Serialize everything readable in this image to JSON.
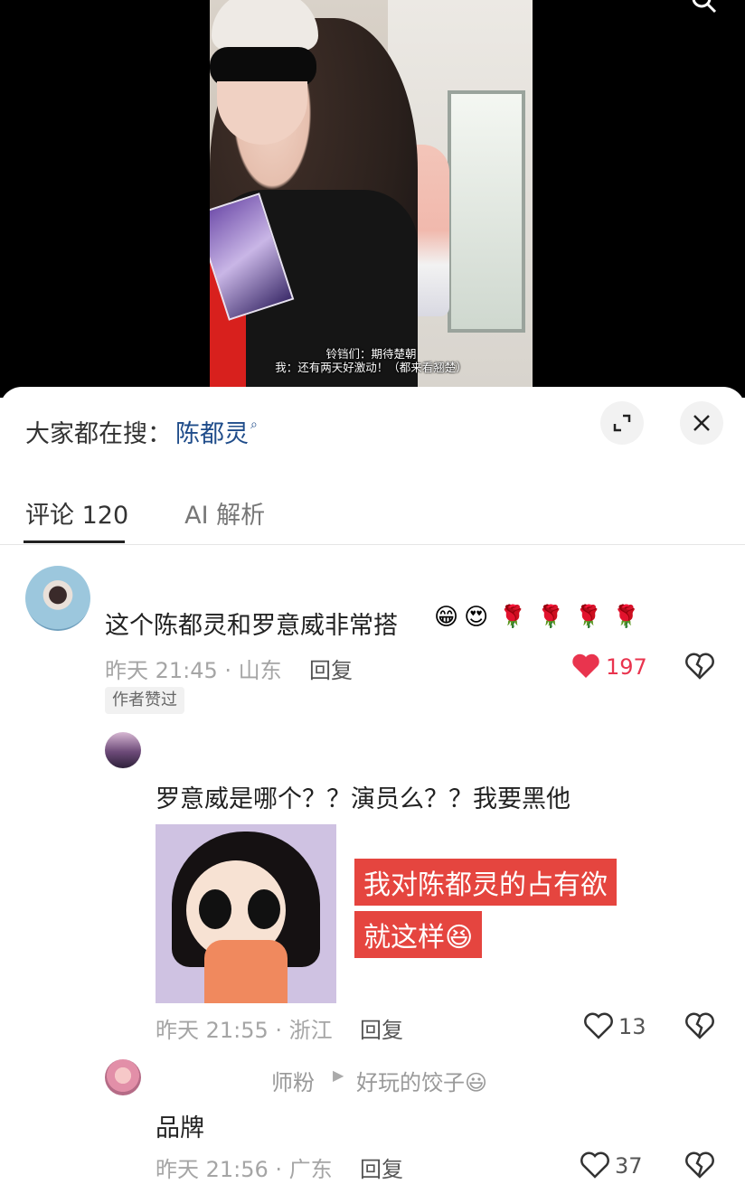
{
  "video": {
    "caption_line1": "铃铛们：期待楚朝",
    "caption_line2": "我：还有两天好激动！（都来看翘楚）"
  },
  "search": {
    "prefix": "大家都在搜：",
    "term": "陈都灵"
  },
  "tabs": [
    {
      "label": "评论 120",
      "active": true
    },
    {
      "label": "AI 解析",
      "active": false
    }
  ],
  "comments": [
    {
      "text": "这个陈都灵和罗意威非常搭",
      "emojis": [
        "😁",
        "😍",
        "🌹",
        "🌹",
        "🌹",
        "🌹"
      ],
      "time_location": "昨天 21:45 · 山东",
      "reply_label": "回复",
      "likes": "197",
      "liked": true,
      "badge": "作者赞过"
    },
    {
      "text": "罗意威是哪个？？演员么？？我要黑他",
      "time_location": "昨天 21:55 · 浙江",
      "reply_label": "回复",
      "likes": "13",
      "sticker_text_line1": "我对陈都灵的占有欲",
      "sticker_text_line2": "就这样😆"
    },
    {
      "author": "师粉",
      "reply_to": "好玩的饺子😃",
      "text": "品牌",
      "time_location": "昨天 21:56 · 广东",
      "reply_label": "回复",
      "likes": "37"
    }
  ],
  "colors": {
    "link_blue": "#1f4c8a",
    "like_red": "#e9344e",
    "caption_red": "#e5453f"
  }
}
